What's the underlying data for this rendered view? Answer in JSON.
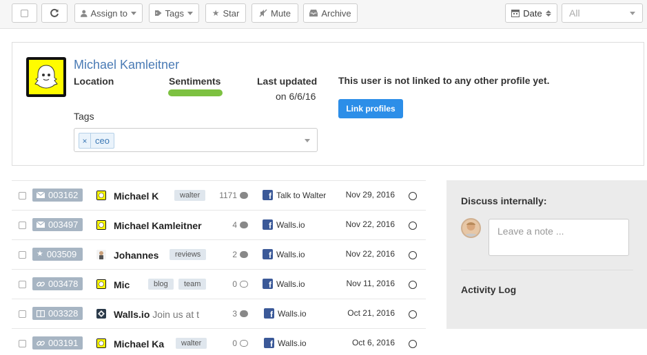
{
  "toolbar": {
    "assign_label": "Assign to",
    "tags_label": "Tags",
    "star_label": "Star",
    "mute_label": "Mute",
    "archive_label": "Archive",
    "sort_label": "Date",
    "filter_value": "All"
  },
  "profile": {
    "name": "Michael Kamleitner",
    "location_label": "Location",
    "sentiments_label": "Sentiments",
    "last_updated_label": "Last updated",
    "last_updated_value": "on 6/6/16",
    "not_linked_text": "This user is not linked to any other profile yet.",
    "link_button": "Link profiles",
    "tags_label": "Tags",
    "tags": [
      {
        "remove": "×",
        "value": "ceo"
      }
    ]
  },
  "rows": [
    {
      "id": "003162",
      "icon": "envelope-icon",
      "name": "Michael K",
      "preview": "",
      "tags": [
        "walter"
      ],
      "count": "1171",
      "bubble": "filled",
      "source": "Talk to Walter",
      "date": "Nov 29, 2016"
    },
    {
      "id": "003497",
      "icon": "envelope-icon",
      "name": "Michael Kamleitner",
      "preview": "",
      "tags": [],
      "count": "4",
      "bubble": "filled",
      "source": "Walls.io",
      "date": "Nov 22, 2016"
    },
    {
      "id": "003509",
      "icon": "star-icon",
      "name": "Johannes",
      "preview": "",
      "tags": [
        "reviews"
      ],
      "count": "2",
      "bubble": "filled",
      "source": "Walls.io",
      "date": "Nov 22, 2016"
    },
    {
      "id": "003478",
      "icon": "link-icon",
      "name": "Mic",
      "preview": "",
      "tags": [
        "blog",
        "team"
      ],
      "count": "0",
      "bubble": "empty",
      "source": "Walls.io",
      "date": "Nov 11, 2016"
    },
    {
      "id": "003328",
      "icon": "columns-icon",
      "name": "Walls.io",
      "preview": "Join us at t",
      "tags": [],
      "count": "3",
      "bubble": "filled",
      "source": "Walls.io",
      "date": "Oct 21, 2016"
    },
    {
      "id": "003191",
      "icon": "link-icon",
      "name": "Michael Ka",
      "preview": "",
      "tags": [
        "walter"
      ],
      "count": "0",
      "bubble": "empty",
      "source": "Walls.io",
      "date": "Oct 6, 2016"
    }
  ],
  "side": {
    "discuss_label": "Discuss internally:",
    "note_placeholder": "Leave a note ...",
    "activity_label": "Activity Log"
  },
  "colors": {
    "accent": "#2c8ee8",
    "name_link": "#4a7bb5",
    "sentiment": "#7dc141",
    "id_badge": "#a7b5c3",
    "facebook": "#3b5998"
  }
}
